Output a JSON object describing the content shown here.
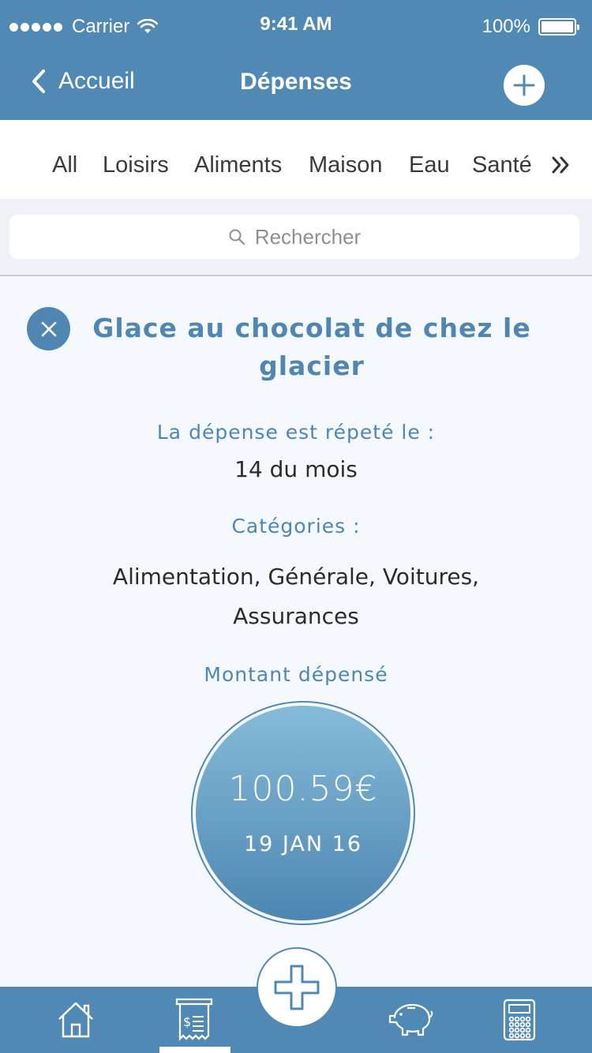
{
  "status_bar": {
    "carrier": "Carrier",
    "time": "9:41 AM",
    "battery": "100%"
  },
  "nav": {
    "back_label": "Accueil",
    "title": "Dépenses"
  },
  "categories": {
    "tabs": [
      "All",
      "Loisirs",
      "Aliments",
      "Maison",
      "Eau",
      "Santé"
    ]
  },
  "search": {
    "placeholder": "Rechercher"
  },
  "expense": {
    "title": "Glace au chocolat de chez le glacier",
    "repeat_label": "La dépense est répeté le :",
    "repeat_value": "14 du mois",
    "categories_label": "Catégories :",
    "categories_value": "Alimentation, Générale, Voitures, Assurances",
    "amount_label": "Montant dépensé",
    "amount": "100.59€",
    "date": "19 JAN 16"
  },
  "tab_bar": {
    "items": [
      "home-icon",
      "receipt-icon",
      "add-icon",
      "piggy-bank-icon",
      "calculator-icon"
    ],
    "active": "receipt-icon"
  },
  "colors": {
    "primary": "#5089b3",
    "accent_text": "#4f86b2",
    "background": "#f5f9fd"
  }
}
